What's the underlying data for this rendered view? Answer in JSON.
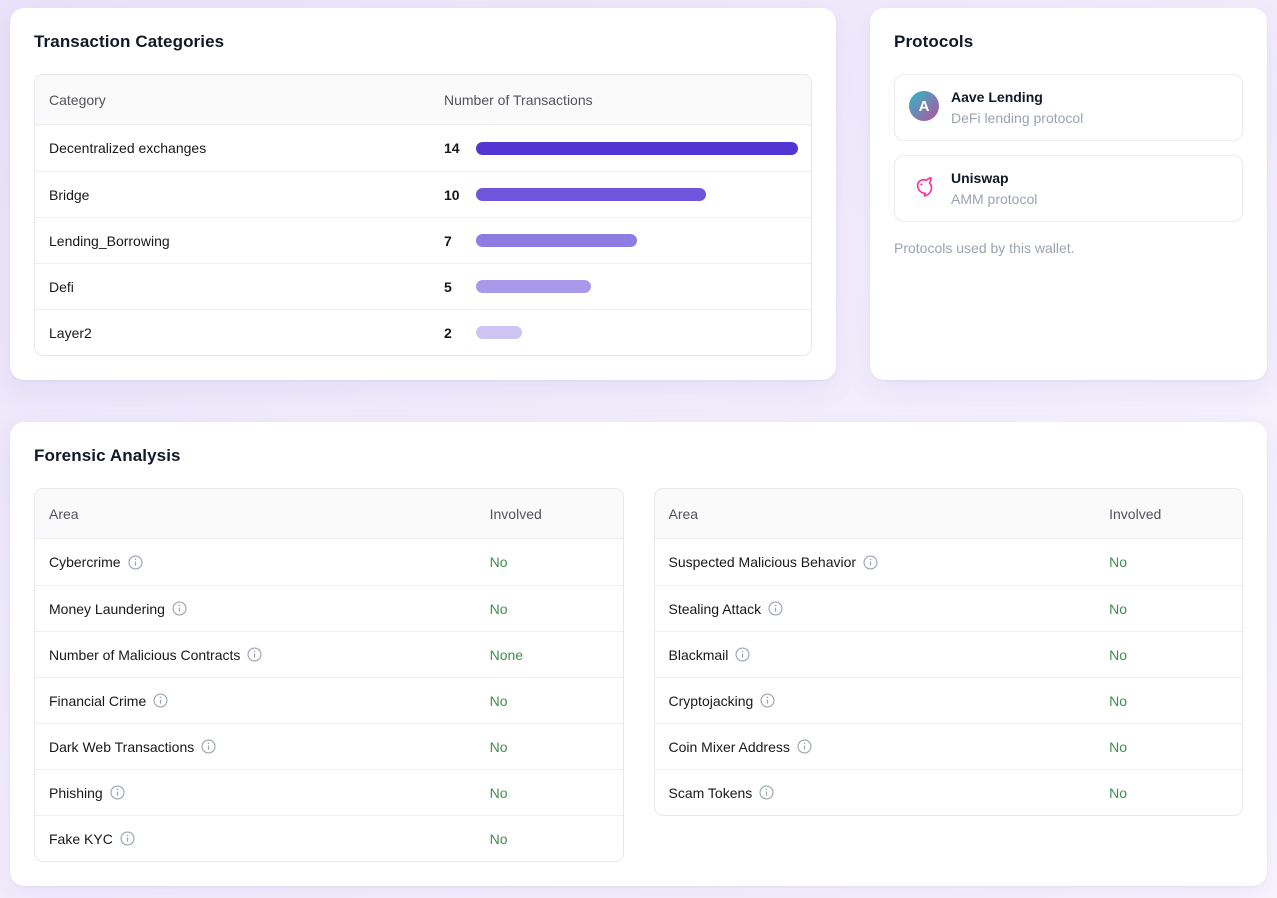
{
  "theme": {
    "accent": "#5435d4",
    "positive_green": "#3e8e50",
    "card_bg": "#ffffff",
    "page_bg_from": "#e9e2f9",
    "page_bg_to": "#f8f5fe"
  },
  "transaction_categories": {
    "title": "Transaction Categories",
    "columns": [
      "Category",
      "Number of Transactions"
    ],
    "max_value": 14,
    "rows": [
      {
        "label": "Decentralized exchanges",
        "value": 14,
        "bar_color": "#5335d2"
      },
      {
        "label": "Bridge",
        "value": 10,
        "bar_color": "#6e55db"
      },
      {
        "label": "Lending_Borrowing",
        "value": 7,
        "bar_color": "#8f7ce3"
      },
      {
        "label": "Defi",
        "value": 5,
        "bar_color": "#a999ea"
      },
      {
        "label": "Layer2",
        "value": 2,
        "bar_color": "#cdc4f3"
      }
    ]
  },
  "protocols": {
    "title": "Protocols",
    "caption": "Protocols used by this wallet.",
    "items": [
      {
        "name": "Aave Lending",
        "description": "DeFi lending protocol",
        "icon": "aave",
        "icon_letter": "A",
        "icon_colors": [
          "#2ebac6",
          "#b6509e"
        ]
      },
      {
        "name": "Uniswap",
        "description": "AMM protocol",
        "icon": "uniswap",
        "icon_color": "#ff2d9c"
      }
    ]
  },
  "forensic_analysis": {
    "title": "Forensic Analysis",
    "columns": [
      "Area",
      "Involved"
    ],
    "left_rows": [
      {
        "label": "Cybercrime",
        "value": "No"
      },
      {
        "label": "Money Laundering",
        "value": "No"
      },
      {
        "label": "Number of Malicious Contracts",
        "value": "None"
      },
      {
        "label": "Financial Crime",
        "value": "No"
      },
      {
        "label": "Dark Web Transactions",
        "value": "No"
      },
      {
        "label": "Phishing",
        "value": "No"
      },
      {
        "label": "Fake KYC",
        "value": "No"
      }
    ],
    "right_rows": [
      {
        "label": "Suspected Malicious Behavior",
        "value": "No"
      },
      {
        "label": "Stealing Attack",
        "value": "No"
      },
      {
        "label": "Blackmail",
        "value": "No"
      },
      {
        "label": "Cryptojacking",
        "value": "No"
      },
      {
        "label": "Coin Mixer Address",
        "value": "No"
      },
      {
        "label": "Scam Tokens",
        "value": "No"
      }
    ]
  }
}
